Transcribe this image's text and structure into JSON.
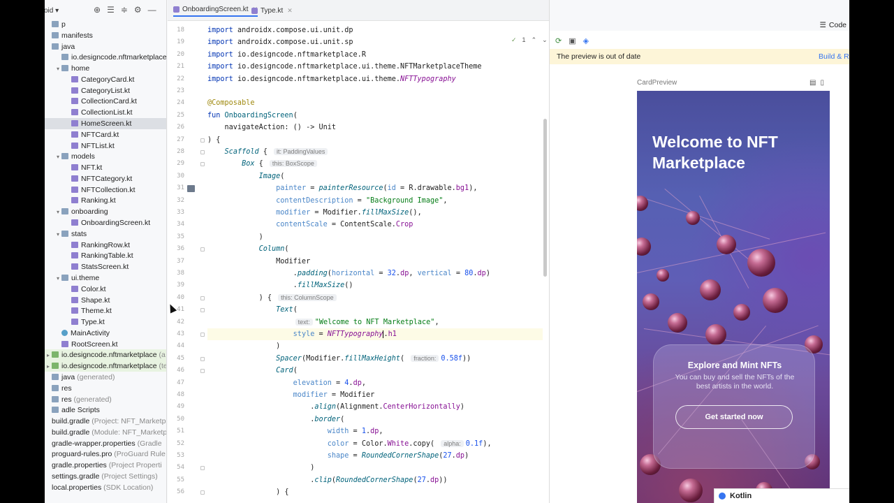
{
  "project": {
    "dropdown_label": "oid",
    "toolbar_icons": [
      "target-icon",
      "collapse-icon",
      "expand-icon",
      "gear-icon",
      "minimize-icon"
    ],
    "tree": [
      {
        "label": "p",
        "sub": "",
        "kind": "folder",
        "indent": 0,
        "arrow": "",
        "state": ""
      },
      {
        "label": "manifests",
        "sub": "",
        "kind": "folder",
        "indent": 0,
        "arrow": "",
        "state": ""
      },
      {
        "label": "java",
        "sub": "",
        "kind": "folder",
        "indent": 0,
        "arrow": "",
        "state": ""
      },
      {
        "label": "io.designcode.nftmarketplace",
        "sub": "",
        "kind": "folder",
        "indent": 1,
        "arrow": "",
        "state": ""
      },
      {
        "label": "home",
        "sub": "",
        "kind": "folder",
        "indent": 1,
        "arrow": "▾",
        "state": ""
      },
      {
        "label": "CategoryCard.kt",
        "sub": "",
        "kind": "kt",
        "indent": 2,
        "arrow": "",
        "state": ""
      },
      {
        "label": "CategoryList.kt",
        "sub": "",
        "kind": "kt",
        "indent": 2,
        "arrow": "",
        "state": ""
      },
      {
        "label": "CollectionCard.kt",
        "sub": "",
        "kind": "kt",
        "indent": 2,
        "arrow": "",
        "state": ""
      },
      {
        "label": "CollectionList.kt",
        "sub": "",
        "kind": "kt",
        "indent": 2,
        "arrow": "",
        "state": ""
      },
      {
        "label": "HomeScreen.kt",
        "sub": "",
        "kind": "kt",
        "indent": 2,
        "arrow": "",
        "state": "selected"
      },
      {
        "label": "NFTCard.kt",
        "sub": "",
        "kind": "kt",
        "indent": 2,
        "arrow": "",
        "state": ""
      },
      {
        "label": "NFTList.kt",
        "sub": "",
        "kind": "kt",
        "indent": 2,
        "arrow": "",
        "state": ""
      },
      {
        "label": "models",
        "sub": "",
        "kind": "folder",
        "indent": 1,
        "arrow": "▾",
        "state": ""
      },
      {
        "label": "NFT.kt",
        "sub": "",
        "kind": "kt",
        "indent": 2,
        "arrow": "",
        "state": ""
      },
      {
        "label": "NFTCategory.kt",
        "sub": "",
        "kind": "kt",
        "indent": 2,
        "arrow": "",
        "state": ""
      },
      {
        "label": "NFTCollection.kt",
        "sub": "",
        "kind": "kt",
        "indent": 2,
        "arrow": "",
        "state": ""
      },
      {
        "label": "Ranking.kt",
        "sub": "",
        "kind": "kt",
        "indent": 2,
        "arrow": "",
        "state": ""
      },
      {
        "label": "onboarding",
        "sub": "",
        "kind": "folder",
        "indent": 1,
        "arrow": "▾",
        "state": ""
      },
      {
        "label": "OnboardingScreen.kt",
        "sub": "",
        "kind": "kt",
        "indent": 2,
        "arrow": "",
        "state": ""
      },
      {
        "label": "stats",
        "sub": "",
        "kind": "folder",
        "indent": 1,
        "arrow": "▾",
        "state": ""
      },
      {
        "label": "RankingRow.kt",
        "sub": "",
        "kind": "kt",
        "indent": 2,
        "arrow": "",
        "state": ""
      },
      {
        "label": "RankingTable.kt",
        "sub": "",
        "kind": "kt",
        "indent": 2,
        "arrow": "",
        "state": ""
      },
      {
        "label": "StatsScreen.kt",
        "sub": "",
        "kind": "kt",
        "indent": 2,
        "arrow": "",
        "state": ""
      },
      {
        "label": "ui.theme",
        "sub": "",
        "kind": "folder",
        "indent": 1,
        "arrow": "▾",
        "state": ""
      },
      {
        "label": "Color.kt",
        "sub": "",
        "kind": "kt",
        "indent": 2,
        "arrow": "",
        "state": ""
      },
      {
        "label": "Shape.kt",
        "sub": "",
        "kind": "kt",
        "indent": 2,
        "arrow": "",
        "state": ""
      },
      {
        "label": "Theme.kt",
        "sub": "",
        "kind": "kt",
        "indent": 2,
        "arrow": "",
        "state": ""
      },
      {
        "label": "Type.kt",
        "sub": "",
        "kind": "kt",
        "indent": 2,
        "arrow": "",
        "state": ""
      },
      {
        "label": "MainActivity",
        "sub": "",
        "kind": "act",
        "indent": 1,
        "arrow": "",
        "state": ""
      },
      {
        "label": "RootScreen.kt",
        "sub": "",
        "kind": "kt",
        "indent": 1,
        "arrow": "",
        "state": ""
      },
      {
        "label": "io.designcode.nftmarketplace",
        "sub": " (a",
        "kind": "green",
        "indent": 0,
        "arrow": "▸",
        "state": "green"
      },
      {
        "label": "io.designcode.nftmarketplace",
        "sub": " (te",
        "kind": "green",
        "indent": 0,
        "arrow": "▸",
        "state": "green"
      },
      {
        "label": "java",
        "sub": " (generated)",
        "kind": "folder",
        "indent": 0,
        "arrow": "",
        "state": ""
      },
      {
        "label": "res",
        "sub": "",
        "kind": "folder",
        "indent": 0,
        "arrow": "",
        "state": ""
      },
      {
        "label": "res",
        "sub": " (generated)",
        "kind": "folder",
        "indent": 0,
        "arrow": "",
        "state": ""
      },
      {
        "label": "adle Scripts",
        "sub": "",
        "kind": "folder",
        "indent": 0,
        "arrow": "",
        "state": ""
      },
      {
        "label": "build.gradle",
        "sub": " (Project: NFT_Marketp",
        "kind": "none",
        "indent": 0,
        "arrow": "",
        "state": ""
      },
      {
        "label": "build.gradle",
        "sub": " (Module: NFT_Marketp",
        "kind": "none",
        "indent": 0,
        "arrow": "",
        "state": ""
      },
      {
        "label": "gradle-wrapper.properties",
        "sub": " (Gradle",
        "kind": "none",
        "indent": 0,
        "arrow": "",
        "state": ""
      },
      {
        "label": "proguard-rules.pro",
        "sub": " (ProGuard Rule",
        "kind": "none",
        "indent": 0,
        "arrow": "",
        "state": ""
      },
      {
        "label": "gradle.properties",
        "sub": " (Project Properti",
        "kind": "none",
        "indent": 0,
        "arrow": "",
        "state": ""
      },
      {
        "label": "settings.gradle",
        "sub": " (Project Settings)",
        "kind": "none",
        "indent": 0,
        "arrow": "",
        "state": ""
      },
      {
        "label": "local.properties",
        "sub": " (SDK Location)",
        "kind": "none",
        "indent": 0,
        "arrow": "",
        "state": ""
      }
    ]
  },
  "editor": {
    "tabs": [
      {
        "label": "OnboardingScreen.kt",
        "active": true
      },
      {
        "label": "Type.kt",
        "active": false
      }
    ],
    "inspection_count": "1",
    "lines": [
      {
        "n": "18",
        "html": "<span class=\"kw\">import</span> androidx.compose.ui.unit.dp"
      },
      {
        "n": "19",
        "html": "<span class=\"kw\">import</span> androidx.compose.ui.unit.sp"
      },
      {
        "n": "20",
        "html": "<span class=\"kw\">import</span> io.designcode.nftmarketplace.R"
      },
      {
        "n": "21",
        "html": "<span class=\"kw\">import</span> io.designcode.nftmarketplace.ui.theme.NFTMarketplaceTheme"
      },
      {
        "n": "22",
        "html": "<span class=\"kw\">import</span> io.designcode.nftmarketplace.ui.theme.<span class=\"purple\">NFTTypography</span>"
      },
      {
        "n": "23",
        "html": ""
      },
      {
        "n": "24",
        "html": "<span class=\"ann\">@Composable</span>"
      },
      {
        "n": "25",
        "html": "<span class=\"kw\">fun</span> <span class=\"fn\">OnboardingScreen</span>("
      },
      {
        "n": "26",
        "html": "    navigateAction: () -> Unit"
      },
      {
        "n": "27",
        "html": ") {"
      },
      {
        "n": "28",
        "html": "    <span class=\"it\">Scaffold</span> { <span class=\"hint\">it: PaddingValues</span>"
      },
      {
        "n": "29",
        "html": "        <span class=\"it\">Box</span> { <span class=\"hint\">this: BoxScope</span>"
      },
      {
        "n": "30",
        "html": "            <span class=\"it\">Image</span>("
      },
      {
        "n": "31",
        "html": "                <span class=\"param\">painter</span> = <span class=\"it\">painterResource</span>(<span class=\"param\">id</span> = R.drawable.<span class=\"prop\">bg1</span>),"
      },
      {
        "n": "32",
        "html": "                <span class=\"param\">contentDescription</span> = <span class=\"str\">\"Background Image\"</span>,"
      },
      {
        "n": "33",
        "html": "                <span class=\"param\">modifier</span> = Modifier.<span class=\"it\">fillMaxSize</span>(),"
      },
      {
        "n": "34",
        "html": "                <span class=\"param\">contentScale</span> = ContentScale.<span class=\"prop\">Crop</span>"
      },
      {
        "n": "35",
        "html": "            )"
      },
      {
        "n": "36",
        "html": "            <span class=\"it\">Column</span>("
      },
      {
        "n": "37",
        "html": "                Modifier"
      },
      {
        "n": "38",
        "html": "                    .<span class=\"it\">padding</span>(<span class=\"param\">horizontal</span> = <span class=\"num\">32</span>.<span class=\"prop\">dp</span>, <span class=\"param\">vertical</span> = <span class=\"num\">80</span>.<span class=\"prop\">dp</span>)"
      },
      {
        "n": "39",
        "html": "                    .<span class=\"it\">fillMaxSize</span>()"
      },
      {
        "n": "40",
        "html": "            ) { <span class=\"hint\">this: ColumnScope</span>"
      },
      {
        "n": "41",
        "html": "                <span class=\"it\">Text</span>("
      },
      {
        "n": "42",
        "html": "                    <span class=\"hint\">text:</span><span class=\"str\">\"Welcome to NFT Marketplace\"</span>,"
      },
      {
        "n": "43",
        "html": "                    <span class=\"param\">style</span> = <span class=\"purple\">NFTTypography</span><span class=\"caret\"></span>.<span class=\"prop\">h1</span>"
      },
      {
        "n": "44",
        "html": "                )"
      },
      {
        "n": "45",
        "html": "                <span class=\"it\">Spacer</span>(Modifier.<span class=\"it\">fillMaxHeight</span>( <span class=\"hint\">fraction:</span><span class=\"num\">0.58f</span>))"
      },
      {
        "n": "46",
        "html": "                <span class=\"it\">Card</span>("
      },
      {
        "n": "47",
        "html": "                    <span class=\"param\">elevation</span> = <span class=\"num\">4</span>.<span class=\"prop\">dp</span>,"
      },
      {
        "n": "48",
        "html": "                    <span class=\"param\">modifier</span> = Modifier"
      },
      {
        "n": "49",
        "html": "                        .<span class=\"it\">align</span>(Alignment.<span class=\"prop\">CenterHorizontally</span>)"
      },
      {
        "n": "50",
        "html": "                        .<span class=\"it\">border</span>("
      },
      {
        "n": "51",
        "html": "                            <span class=\"param\">width</span> = <span class=\"num\">1</span>.<span class=\"prop\">dp</span>,"
      },
      {
        "n": "52",
        "html": "                            <span class=\"param\">color</span> = Color.<span class=\"prop\">White</span>.copy( <span class=\"hint\">alpha:</span><span class=\"num\">0.1f</span>),"
      },
      {
        "n": "53",
        "html": "                            <span class=\"param\">shape</span> = <span class=\"it\">RoundedCornerShape</span>(<span class=\"num\">27</span>.<span class=\"prop\">dp</span>)"
      },
      {
        "n": "54",
        "html": "                        )"
      },
      {
        "n": "55",
        "html": "                        .<span class=\"it\">clip</span>(<span class=\"it\">RoundedCornerShape</span>(<span class=\"num\">27</span>.<span class=\"prop\">dp</span>))"
      },
      {
        "n": "56",
        "html": "                ) {"
      }
    ]
  },
  "preview": {
    "code_toggle": "Code",
    "banner_text": "The preview is out of date",
    "banner_action": "Build & R",
    "label": "CardPreview",
    "hero_title": "Welcome to NFT Marketplace",
    "card_title": "Explore and Mint NFTs",
    "card_body": "You can buy and sell the NFTs of the best artists in the world.",
    "cta_label": "Get started now"
  },
  "toast": {
    "label": "Kotlin"
  },
  "colors": {
    "accent": "#3574f0",
    "banner": "#fdf5d8",
    "selection": "#dcdfe4",
    "current_line": "#fdfbe6"
  }
}
